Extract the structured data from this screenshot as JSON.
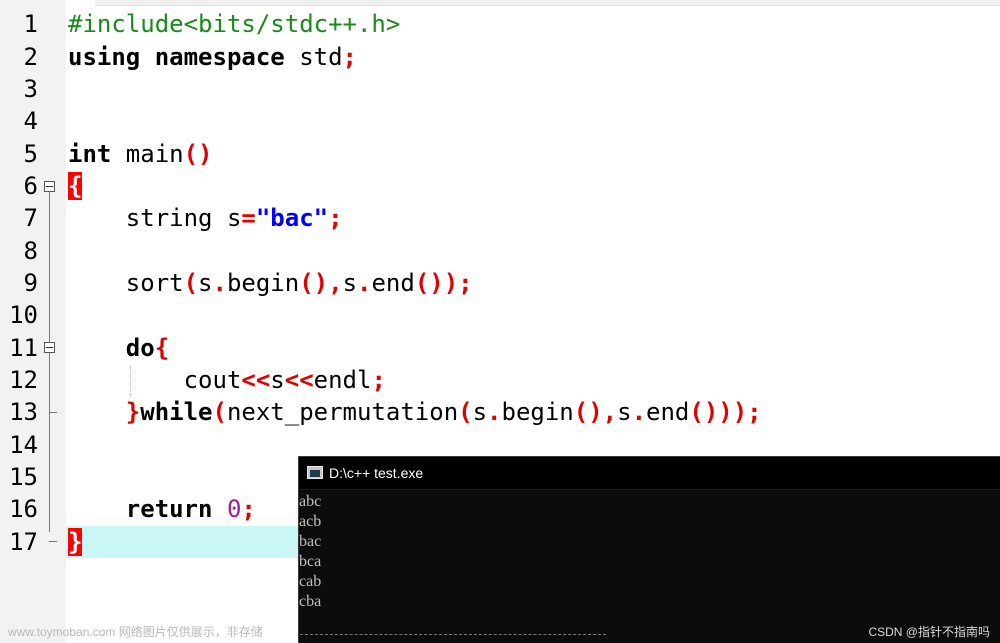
{
  "editor": {
    "line_numbers": [
      "1",
      "2",
      "3",
      "4",
      "5",
      "6",
      "7",
      "8",
      "9",
      "10",
      "11",
      "12",
      "13",
      "14",
      "15",
      "16",
      "17"
    ],
    "lines": {
      "l1": {
        "pp": "#include<bits/stdc++.h>"
      },
      "l2": {
        "kw": "using namespace",
        "rest": " std",
        "sym": ";"
      },
      "l5": {
        "kw": "int",
        "rest": " main",
        "sym": "()"
      },
      "l6": {
        "brace": "{"
      },
      "l7": {
        "indent": "    ",
        "t1": "string s",
        "s1": "=",
        "str": "\"bac\"",
        "s2": ";"
      },
      "l9": {
        "indent": "    ",
        "t1": "sort",
        "s1": "(",
        "t2": "s",
        "s2": ".",
        "t3": "begin",
        "s3": "(),",
        "t4": "s",
        "s4": ".",
        "t5": "end",
        "s5": "());"
      },
      "l11": {
        "indent": "    ",
        "kw": "do",
        "sym": "{"
      },
      "l12": {
        "indent": "        ",
        "t1": "cout",
        "s1": "<<",
        "t2": "s",
        "s2": "<<",
        "t3": "endl",
        "s3": ";"
      },
      "l13": {
        "indent": "    ",
        "s0": "}",
        "kw": "while",
        "s1": "(",
        "t1": "next_permutation",
        "s2": "(",
        "t2": "s",
        "s3": ".",
        "t3": "begin",
        "s4": "(),",
        "t4": "s",
        "s5": ".",
        "t5": "end",
        "s6": "()));"
      },
      "l16": {
        "indent": "    ",
        "kw": "return",
        "num": "0",
        "sym": ";"
      },
      "l17": {
        "brace": "}"
      }
    }
  },
  "console": {
    "title": "D:\\c++ test.exe",
    "output": [
      "abc",
      "acb",
      "bac",
      "bca",
      "cab",
      "cba"
    ]
  },
  "watermark": {
    "left": "www.toymoban.com 网络图片仅供展示，非存储",
    "right": "CSDN @指针不指南吗"
  },
  "colors": {
    "preprocessor": "#1b8a1b",
    "symbol": "#e00000",
    "string": "#0000ff",
    "number": "#9b1f9b",
    "current_line": "#caf6f6",
    "console_bg": "#0c0c0c"
  }
}
